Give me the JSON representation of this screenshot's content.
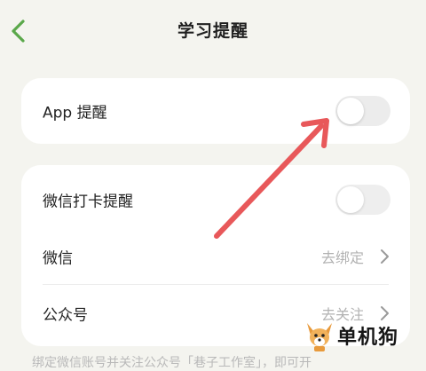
{
  "nav": {
    "title": "学习提醒"
  },
  "app_reminder": {
    "label": "App 提醒",
    "enabled": false
  },
  "wechat_card": {
    "checkin_label": "微信打卡提醒",
    "checkin_enabled": false,
    "wechat_label": "微信",
    "wechat_action": "去绑定",
    "official_label": "公众号",
    "official_action": "去关注"
  },
  "footnote": "绑定微信账号并关注公众号「巷子工作室」，即可开",
  "watermark": {
    "text": "单机狗"
  },
  "colors": {
    "accent": "#5aa84a",
    "annotation": "#e8585a"
  }
}
